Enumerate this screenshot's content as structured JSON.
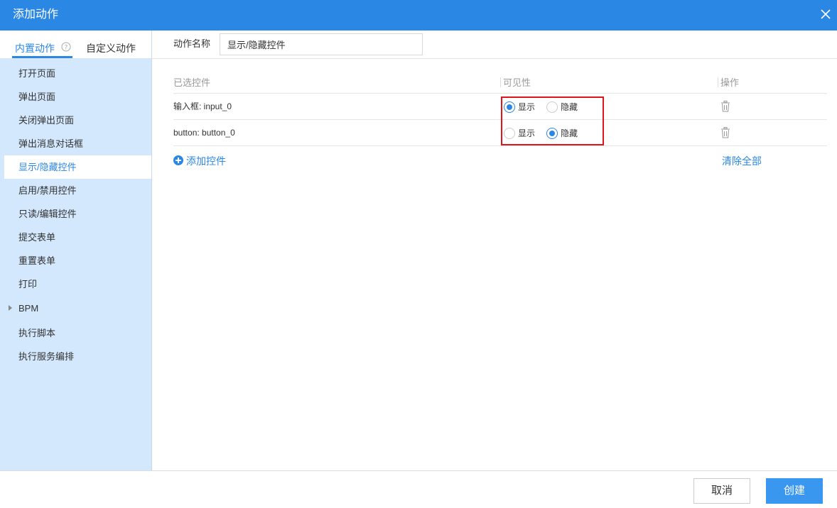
{
  "dialog": {
    "title": "添加动作"
  },
  "tabs": [
    {
      "label": "内置动作",
      "active": true
    },
    {
      "label": "自定义动作",
      "active": false
    }
  ],
  "nav": {
    "items": [
      {
        "label": "打开页面"
      },
      {
        "label": "弹出页面"
      },
      {
        "label": "关闭弹出页面"
      },
      {
        "label": "弹出消息对话框"
      },
      {
        "label": "显示/隐藏控件",
        "active": true
      },
      {
        "label": "启用/禁用控件"
      },
      {
        "label": "只读/编辑控件"
      },
      {
        "label": "提交表单"
      },
      {
        "label": "重置表单"
      },
      {
        "label": "打印"
      },
      {
        "label": "BPM",
        "group": true
      },
      {
        "label": "执行脚本"
      },
      {
        "label": "执行服务编排"
      }
    ]
  },
  "action_name": {
    "label": "动作名称",
    "value": "显示/隐藏控件"
  },
  "table": {
    "headers": [
      "已选控件",
      "可见性",
      "操作"
    ],
    "rows": [
      {
        "name": "输入框: input_0",
        "show_label": "显示",
        "hide_label": "隐藏",
        "visibility": "显示"
      },
      {
        "name": "button: button_0",
        "show_label": "显示",
        "hide_label": "隐藏",
        "visibility": "隐藏"
      }
    ]
  },
  "links": {
    "add_control": "添加控件",
    "clear_all": "清除全部"
  },
  "footer": {
    "cancel": "取消",
    "create": "创建"
  },
  "colors": {
    "primary": "#2b87e4",
    "sidebar_bg": "#d3e7fd",
    "highlight": "#e0151b"
  }
}
